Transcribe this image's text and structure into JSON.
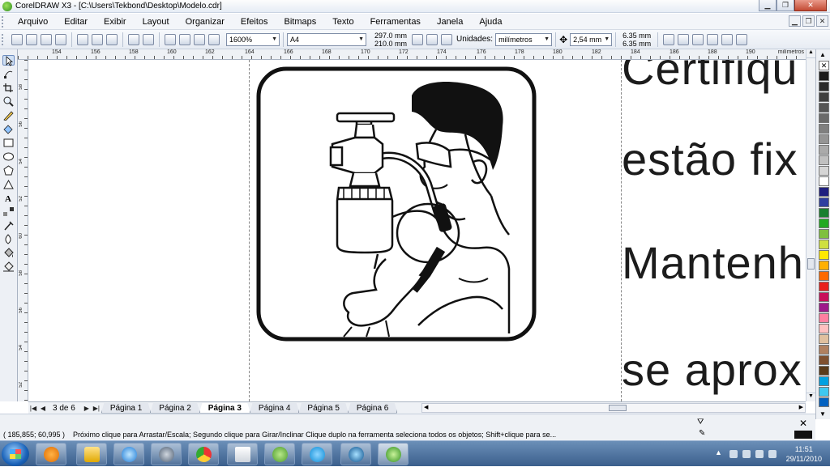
{
  "window": {
    "title": "CorelDRAW X3 - [C:\\Users\\Tekbond\\Desktop\\Modelo.cdr]",
    "controls": [
      "minimize",
      "restore",
      "close"
    ]
  },
  "menubar": {
    "items": [
      "Arquivo",
      "Editar",
      "Exibir",
      "Layout",
      "Organizar",
      "Efeitos",
      "Bitmaps",
      "Texto",
      "Ferramentas",
      "Janela",
      "Ajuda"
    ]
  },
  "toolbar": {
    "zoom": "1600%",
    "paper_size": "A4",
    "page_width": "297.0 mm",
    "page_height": "210.0 mm",
    "units_label": "Unidades:",
    "units_value": "milímetros",
    "nudge": "2,54 mm",
    "dup_x": "6.35 mm",
    "dup_y": "6.35 mm"
  },
  "ruler": {
    "h_labels": [
      "154",
      "156",
      "158",
      "160",
      "162",
      "164",
      "166",
      "168",
      "170",
      "172",
      "174",
      "176",
      "178",
      "180",
      "182",
      "184",
      "186",
      "188",
      "190"
    ],
    "unit": "milímetros",
    "v_labels": [
      "58",
      "56",
      "54",
      "52",
      "60",
      "58",
      "56",
      "54",
      "52"
    ]
  },
  "canvas": {
    "text_lines": [
      "Certifiqu",
      "estão  fix",
      "Mantenh",
      "se aprox"
    ]
  },
  "pages": {
    "count_label": "3 de 6",
    "tabs": [
      "Página 1",
      "Página 2",
      "Página 3",
      "Página 4",
      "Página 5",
      "Página 6"
    ],
    "active_index": 2
  },
  "status": {
    "coords": "( 185,855; 60,995 )",
    "message": "Próximo clique para Arrastar/Escala; Segundo clique para Girar/Inclinar Clique duplo na ferramenta seleciona todos os objetos; Shift+clique para se..."
  },
  "palette": {
    "colors": [
      "#ffffff",
      "#1a1a1a",
      "#2b2b2b",
      "#3f3f3f",
      "#555555",
      "#6a6a6a",
      "#808080",
      "#959595",
      "#aaaaaa",
      "#c0c0c0",
      "#d5d5d5",
      "#ffffff",
      "#1f1f7f",
      "#2f3f9f",
      "#1a7f2f",
      "#22aa22",
      "#7fc03f",
      "#cfe03f",
      "#ffe800",
      "#ffb000",
      "#ff6a00",
      "#e8201c",
      "#c8105a",
      "#9e1a8a",
      "#ff7fa0",
      "#ffc0c0",
      "#e0c09f",
      "#b08060",
      "#7f5030",
      "#5a3a1a",
      "#00a0e0",
      "#40c8f0",
      "#0060c0"
    ]
  },
  "taskbar": {
    "apps": [
      "windows-media-player",
      "windows-explorer",
      "internet-explorer",
      "messenger",
      "chrome",
      "fax-scan",
      "contacts",
      "skype",
      "teamspeak",
      "coreldraw"
    ],
    "time": "11:51",
    "date": "29/11/2010"
  }
}
